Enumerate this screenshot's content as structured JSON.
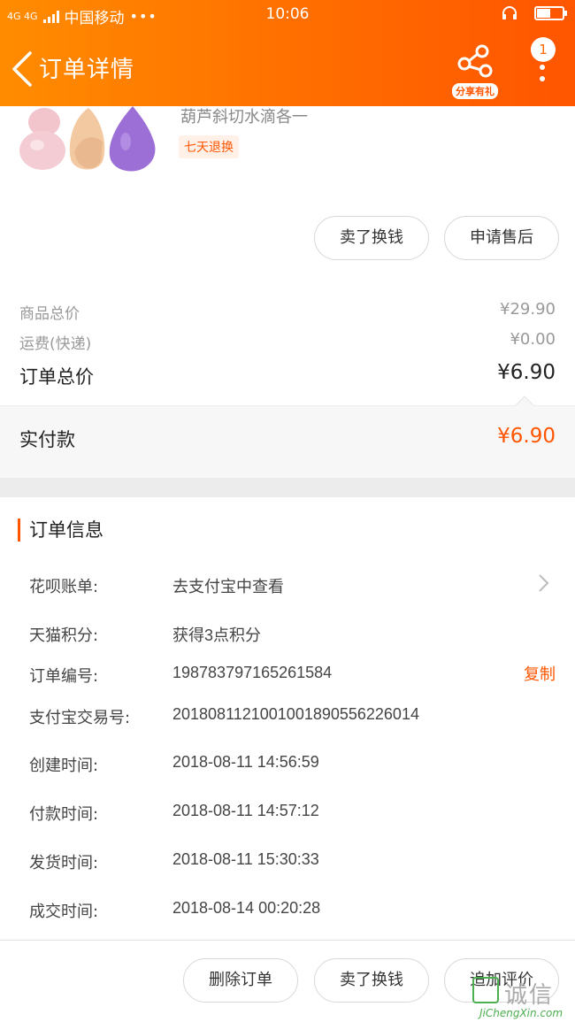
{
  "status_bar": {
    "network": "4G 4G",
    "carrier": "中国移动",
    "dots": "•••",
    "time": "10:06",
    "battery_level": 0.55
  },
  "nav": {
    "title": "订单详情",
    "share_label": "分享有礼",
    "badge_count": "1"
  },
  "product": {
    "name": "葫芦斜切水滴各一",
    "tag": "七天退换",
    "actions": {
      "sell": "卖了换钱",
      "after_sale": "申请售后"
    }
  },
  "prices": {
    "goods_label": "商品总价",
    "goods_value": "¥29.90",
    "shipping_label": "运费(快递)",
    "shipping_value": "¥0.00",
    "total_label": "订单总价",
    "total_value": "¥6.90",
    "paid_label": "实付款",
    "paid_value": "¥6.90"
  },
  "order_info": {
    "heading": "订单信息",
    "rows": [
      {
        "label": "花呗账单:",
        "value": "去支付宝中查看"
      },
      {
        "label": "天猫积分:",
        "value": "获得3点积分"
      },
      {
        "label": "订单编号:",
        "value": "198783797165261584"
      },
      {
        "label": "支付宝交易号:",
        "value": "2018081121001001890556226014"
      },
      {
        "label": "创建时间:",
        "value": "2018-08-11 14:56:59"
      },
      {
        "label": "付款时间:",
        "value": "2018-08-11 14:57:12"
      },
      {
        "label": "发货时间:",
        "value": "2018-08-11 15:30:33"
      },
      {
        "label": "成交时间:",
        "value": "2018-08-14 00:20:28"
      }
    ],
    "copy_label": "复制"
  },
  "bottom_actions": {
    "delete": "删除订单",
    "sell": "卖了换钱",
    "add_review": "追加评价"
  },
  "watermark": {
    "text": "诚信",
    "sub": "JiChengXin.com"
  },
  "colors": {
    "accent": "#ff5500",
    "header_start": "#ff8c00",
    "header_end": "#ff5500"
  }
}
